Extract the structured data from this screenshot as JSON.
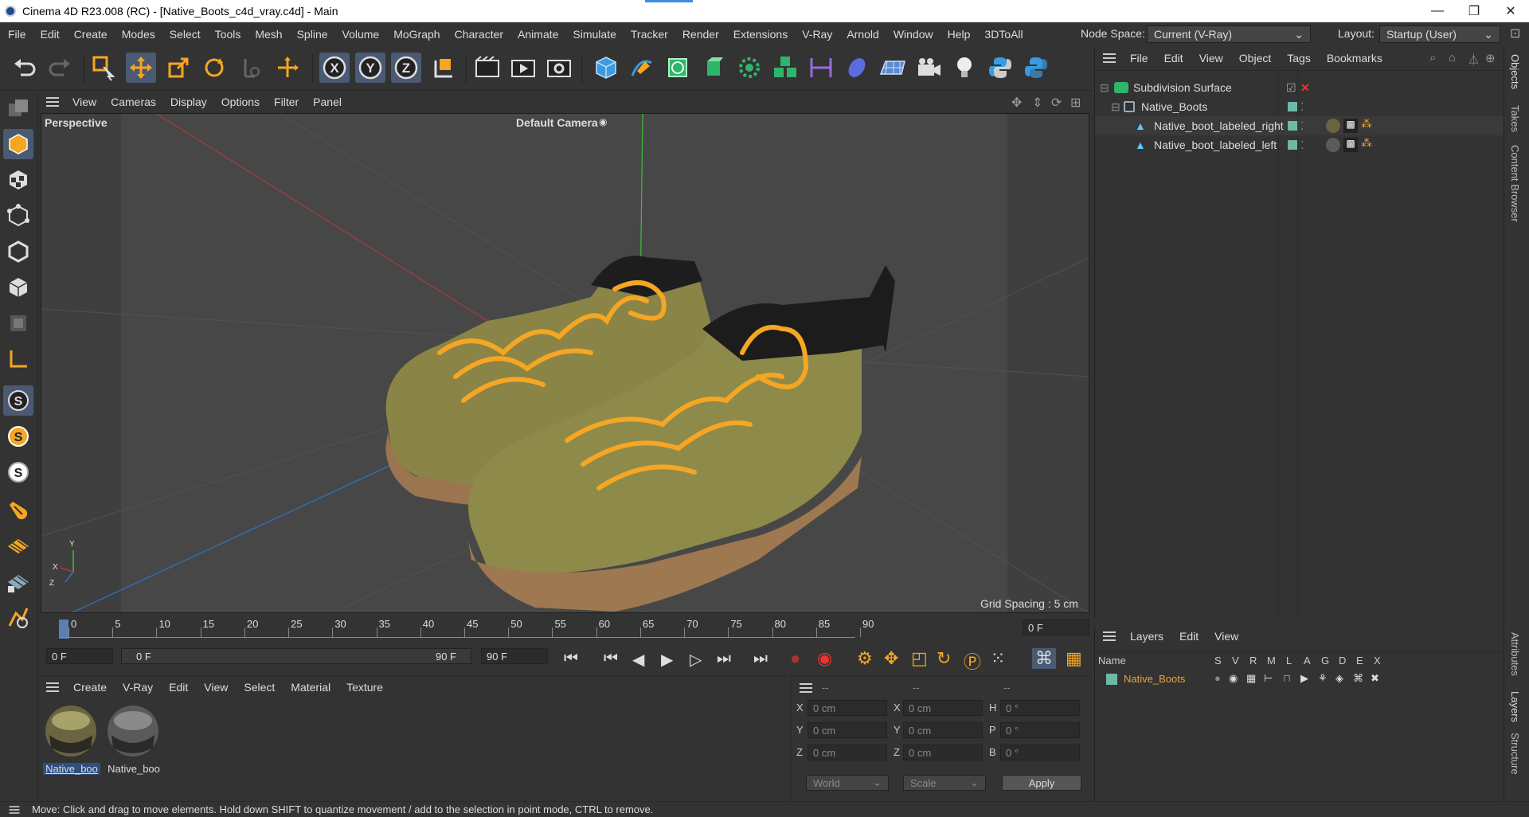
{
  "window": {
    "title": "Cinema 4D R23.008 (RC) - [Native_Boots_c4d_vray.c4d] - Main",
    "minimize": "—",
    "maximize": "❐",
    "close": "✕"
  },
  "menubar": {
    "items": [
      "File",
      "Edit",
      "Create",
      "Modes",
      "Select",
      "Tools",
      "Mesh",
      "Spline",
      "Volume",
      "MoGraph",
      "Character",
      "Animate",
      "Simulate",
      "Tracker",
      "Render",
      "Extensions",
      "V-Ray",
      "Arnold",
      "Window",
      "Help",
      "3DToAll"
    ],
    "node_space_label": "Node Space:",
    "node_space_value": "Current (V-Ray)",
    "layout_label": "Layout:",
    "layout_value": "Startup (User)"
  },
  "viewport": {
    "menu": [
      "View",
      "Cameras",
      "Display",
      "Options",
      "Filter",
      "Panel"
    ],
    "view_name": "Perspective",
    "camera": "Default Camera",
    "grid_spacing": "Grid Spacing : 5 cm",
    "axis_x": "X",
    "axis_y": "Y",
    "axis_z": "Z"
  },
  "timeline": {
    "ticks": [
      "0",
      "5",
      "10",
      "15",
      "20",
      "25",
      "30",
      "35",
      "40",
      "45",
      "50",
      "55",
      "60",
      "65",
      "70",
      "75",
      "80",
      "85",
      "90"
    ],
    "current_frame": "0 F",
    "start_frame": "0 F",
    "range_start": "0 F",
    "range_end": "90 F",
    "end_frame": "90 F"
  },
  "material_manager": {
    "menu": [
      "Create",
      "V-Ray",
      "Edit",
      "View",
      "Select",
      "Material",
      "Texture"
    ],
    "materials": [
      {
        "label": "Native_boo",
        "selected": true
      },
      {
        "label": "Native_boo",
        "selected": false
      }
    ]
  },
  "coordinates": {
    "header": [
      "--",
      "--",
      "--"
    ],
    "rows": [
      {
        "a": "X",
        "av": "0 cm",
        "b": "X",
        "bv": "0 cm",
        "c": "H",
        "cv": "0 °"
      },
      {
        "a": "Y",
        "av": "0 cm",
        "b": "Y",
        "bv": "0 cm",
        "c": "P",
        "cv": "0 °"
      },
      {
        "a": "Z",
        "av": "0 cm",
        "b": "Z",
        "bv": "0 cm",
        "c": "B",
        "cv": "0 °"
      }
    ],
    "space": "World",
    "mode": "Scale",
    "apply": "Apply"
  },
  "objects": {
    "menu": [
      "File",
      "Edit",
      "View",
      "Object",
      "Tags",
      "Bookmarks"
    ],
    "rows": [
      {
        "name": "Subdivision Surface",
        "type": "subdivision"
      },
      {
        "name": "Native_Boots",
        "type": "null"
      },
      {
        "name": "Native_boot_labeled_right",
        "type": "polygon"
      },
      {
        "name": "Native_boot_labeled_left",
        "type": "polygon"
      }
    ]
  },
  "layers": {
    "menu": [
      "Layers",
      "Edit",
      "View"
    ],
    "columns": [
      "Name",
      "S",
      "V",
      "R",
      "M",
      "L",
      "A",
      "G",
      "D",
      "E",
      "X"
    ],
    "rows": [
      {
        "name": "Native_Boots",
        "color": "#6fb8a8"
      }
    ]
  },
  "right_tabs": [
    "Objects",
    "Takes",
    "Content Browser",
    "Attributes",
    "Layers",
    "Structure"
  ],
  "status": "Move: Click and drag to move elements. Hold down SHIFT to quantize movement / add to the selection in point mode, CTRL to remove.",
  "colors": {
    "accent": "#3b8dea",
    "orange": "#f5a623",
    "layer_name": "#e8a33c"
  }
}
